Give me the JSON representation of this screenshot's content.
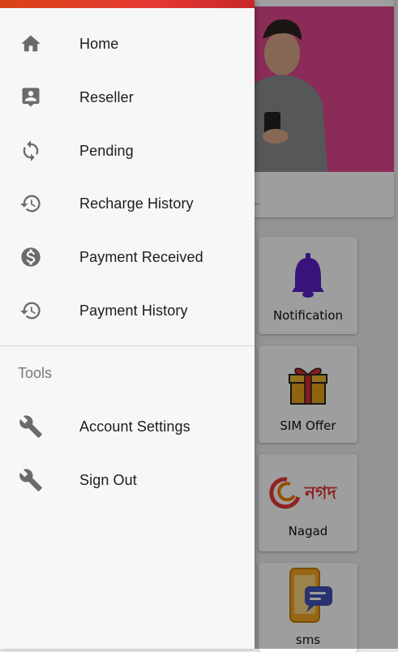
{
  "background_app": {
    "banner_caption": "..",
    "tiles": [
      {
        "label": "Notification",
        "icon": "bell-icon"
      },
      {
        "label": "SIM Offer",
        "icon": "gift-icon"
      },
      {
        "label": "Nagad",
        "icon": "nagad-logo",
        "logo_text": "নগদ"
      },
      {
        "label": "sms",
        "icon": "sms-icon"
      }
    ]
  },
  "drawer": {
    "items": [
      {
        "label": "Home",
        "icon": "home-icon"
      },
      {
        "label": "Reseller",
        "icon": "contact-card-icon"
      },
      {
        "label": "Pending",
        "icon": "sync-icon"
      },
      {
        "label": "Recharge History",
        "icon": "history-icon"
      },
      {
        "label": "Payment Received",
        "icon": "dollar-circle-icon"
      },
      {
        "label": "Payment History",
        "icon": "history-icon"
      }
    ],
    "tools_header": "Tools",
    "tools_items": [
      {
        "label": "Account Settings",
        "icon": "wrench-icon"
      },
      {
        "label": "Sign Out",
        "icon": "wrench-icon"
      }
    ]
  },
  "colors": {
    "accent": "#e53935",
    "icon_gray": "#6b6b6b",
    "banner_pink": "#e0468f",
    "bell_purple": "#5b1fc9"
  }
}
